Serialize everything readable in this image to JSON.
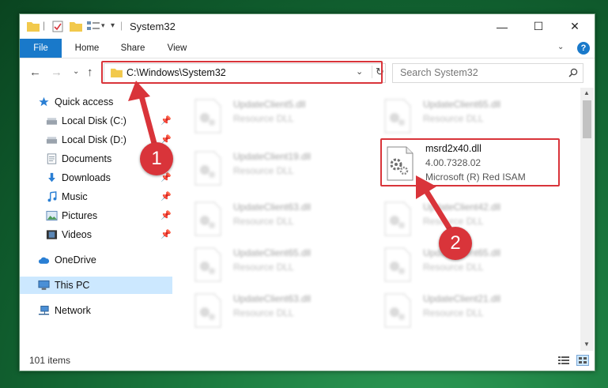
{
  "window": {
    "title": "System32",
    "controls": {
      "minimize": "—",
      "maximize": "☐",
      "close": "✕"
    }
  },
  "ribbon": {
    "tabs": [
      "File",
      "Home",
      "Share",
      "View"
    ],
    "help_icon": "?"
  },
  "address": {
    "path": "C:\\Windows\\System32",
    "search_placeholder": "Search System32"
  },
  "nav_pane": {
    "items": [
      {
        "label": "Quick access",
        "icon": "star-icon",
        "pinned": false
      },
      {
        "label": "Local Disk (C:)",
        "icon": "drive-icon",
        "pinned": true
      },
      {
        "label": "Local Disk (D:)",
        "icon": "drive-icon",
        "pinned": true
      },
      {
        "label": "Documents",
        "icon": "documents-icon",
        "pinned": true
      },
      {
        "label": "Downloads",
        "icon": "download-icon",
        "pinned": true
      },
      {
        "label": "Music",
        "icon": "music-icon",
        "pinned": true
      },
      {
        "label": "Pictures",
        "icon": "pictures-icon",
        "pinned": true
      },
      {
        "label": "Videos",
        "icon": "videos-icon",
        "pinned": true
      },
      {
        "label": "OneDrive",
        "icon": "cloud-icon",
        "pinned": false
      },
      {
        "label": "This PC",
        "icon": "computer-icon",
        "pinned": false,
        "selected": true
      },
      {
        "label": "Network",
        "icon": "network-icon",
        "pinned": false
      }
    ]
  },
  "files": {
    "left_column": [
      {
        "name": "UpdateClient5.dll",
        "type": "Resource DLL"
      },
      {
        "name": "UpdateClient19.dll",
        "type": "Resource DLL"
      },
      {
        "name": "UpdateClient63.dll",
        "type": "Resource DLL"
      },
      {
        "name": "UpdateClient65.dll",
        "type": "Resource DLL"
      },
      {
        "name": "UpdateClient63.dll",
        "type": "Resource DLL"
      }
    ],
    "right_column": [
      {
        "name": "UpdateClient65.dll",
        "type": "Resource DLL"
      },
      {
        "name": "msrd2x40.dll",
        "version": "4.00.7328.02",
        "type": "Microsoft (R) Red ISAM",
        "highlighted": true
      },
      {
        "name": "UpdateClient42.dll",
        "type": "Resource DLL"
      },
      {
        "name": "UpdateClient65.dll",
        "type": "Resource DLL"
      },
      {
        "name": "UpdateClient21.dll",
        "type": "Resource DLL"
      }
    ]
  },
  "status": {
    "item_count": "101 items"
  },
  "annotations": {
    "step1": "1",
    "step2": "2",
    "color": "#d9343a"
  }
}
